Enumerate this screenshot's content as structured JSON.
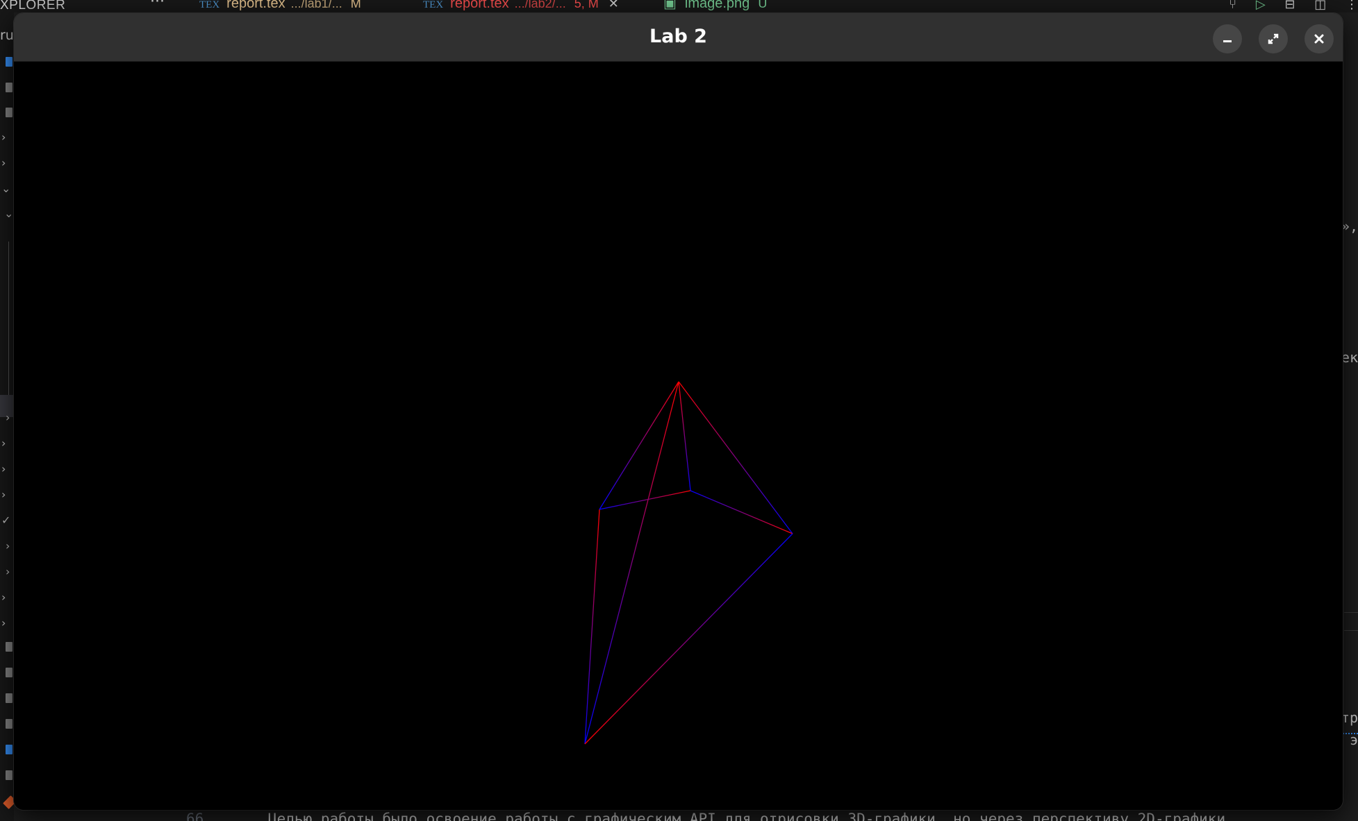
{
  "editor": {
    "sidebar_title": "XPLORER",
    "sidebar_fragment": "ru",
    "sidebar_more": "···",
    "tabs": [
      {
        "icon": "TEX",
        "name": "report.tex",
        "path": ".../lab1/...",
        "flag": "M"
      },
      {
        "icon": "TEX",
        "name": "report.tex",
        "path": ".../lab2/...",
        "flag": "5, M",
        "close": "✕"
      },
      {
        "icon": "image-file-icon",
        "name": "image.png",
        "flag": "U"
      }
    ],
    "right_fragments": [
      "»,",
      "ек",
      "тр",
      "э"
    ],
    "bottom_line_number": "66",
    "bottom_line_text": "Целью работы было освоение работы с графическим API для отрисовки 3D-графики, но через перспективу 2D-графики"
  },
  "window": {
    "title": "Lab 2",
    "buttons": [
      "minimize-icon",
      "maximize-icon",
      "close-icon"
    ],
    "background": "#000000"
  },
  "scene": {
    "object": "wireframe-tetrahedron",
    "colors": {
      "red": "#ff0000",
      "blue": "#0000ff"
    }
  }
}
